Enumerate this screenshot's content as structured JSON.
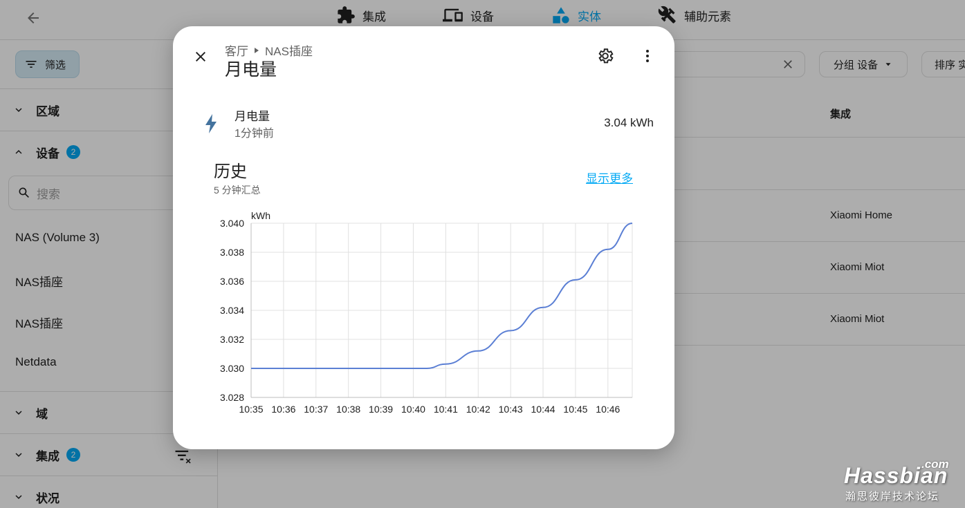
{
  "topbar": {
    "tabs": [
      {
        "label": "集成",
        "icon": "puzzle-icon"
      },
      {
        "label": "设备",
        "icon": "devices-icon"
      },
      {
        "label": "实体",
        "icon": "shapes-icon"
      },
      {
        "label": "辅助元素",
        "icon": "tools-icon"
      }
    ]
  },
  "sidebar": {
    "filter_label": "筛选",
    "sections": {
      "area": "区域",
      "device": "设备",
      "device_badge": "2",
      "domain": "域",
      "integration": "集成",
      "integration_badge": "2",
      "status": "状况"
    },
    "search_placeholder": "搜索",
    "device_items": [
      "NAS (Volume 3)",
      "NAS插座",
      "NAS插座",
      "Netdata"
    ]
  },
  "main": {
    "group_label": "分组 设备",
    "sort_label": "排序 实",
    "column_integration": "集成",
    "rows": [
      "Xiaomi Home",
      "Xiaomi Miot",
      "Xiaomi Miot"
    ]
  },
  "dialog": {
    "breadcrumb_area": "客厅",
    "breadcrumb_device": "NAS插座",
    "title": "月电量",
    "state": {
      "name": "月电量",
      "last_changed": "1分钟前",
      "value": "3.04 kWh"
    },
    "history": {
      "title": "历史",
      "subtitle": "5 分钟汇总",
      "show_more": "显示更多"
    }
  },
  "chart_data": {
    "type": "line",
    "ylabel": "kWh",
    "ylim": [
      3.028,
      3.04
    ],
    "yticks": [
      "3.040",
      "3.038",
      "3.036",
      "3.034",
      "3.032",
      "3.030",
      "3.028"
    ],
    "xticks": [
      "10:35",
      "10:36",
      "10:37",
      "10:38",
      "10:39",
      "10:40",
      "10:41",
      "10:42",
      "10:43",
      "10:44",
      "10:45",
      "10:46"
    ],
    "x_minutes_range": [
      "10:35",
      "10:46:45"
    ],
    "series": [
      {
        "color": "#5b7fd4",
        "x": [
          "10:35",
          "10:36",
          "10:37",
          "10:38",
          "10:39",
          "10:40",
          "10:40:25",
          "10:41",
          "10:42",
          "10:43",
          "10:44",
          "10:45",
          "10:46",
          "10:46:45"
        ],
        "values": [
          3.03,
          3.03,
          3.03,
          3.03,
          3.03,
          3.03,
          3.03,
          3.0303,
          3.0312,
          3.0326,
          3.0342,
          3.0361,
          3.0382,
          3.04
        ]
      }
    ],
    "grid": true
  },
  "watermark": {
    "com": ".com",
    "brand": "Hassbian",
    "sub": "瀚思彼岸技术论坛"
  }
}
